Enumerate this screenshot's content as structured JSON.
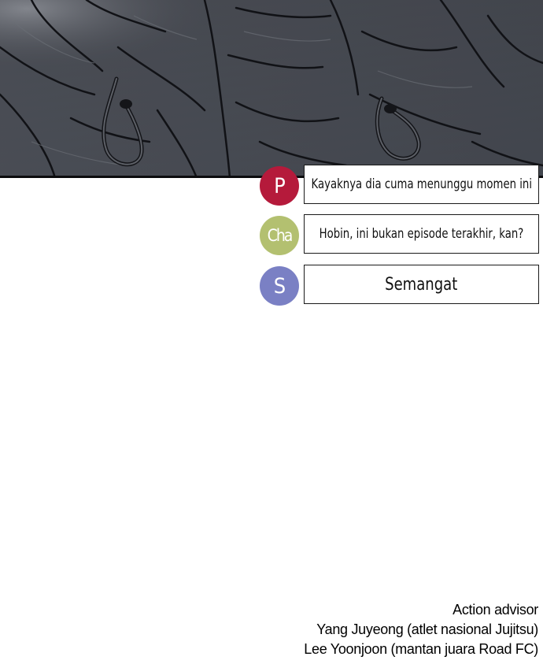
{
  "comments": [
    {
      "avatar_letter": "P",
      "avatar_color": "#b51a3b",
      "text": "Kayaknya dia cuma menunggu momen ini"
    },
    {
      "avatar_letter": "Cha",
      "avatar_color": "#b3c070",
      "text": "Hobin, ini bukan episode terakhir, kan?"
    },
    {
      "avatar_letter": "S",
      "avatar_color": "#7a80c4",
      "text": "Semangat"
    }
  ],
  "credits": {
    "heading": "Action advisor",
    "line1": "Yang Juyeong (atlet nasional Jujitsu)",
    "line2": "Lee Yoonjoon (mantan juara Road FC)"
  }
}
